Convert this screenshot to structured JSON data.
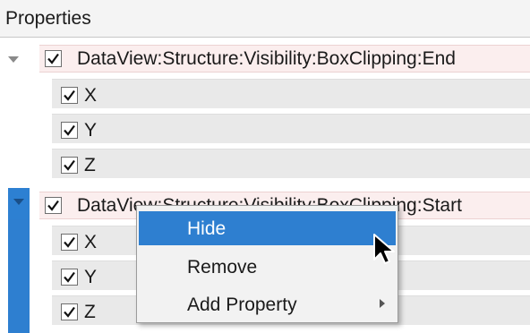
{
  "header": {
    "title": "Properties"
  },
  "groups": [
    {
      "label": "DataView:Structure:Visibility:BoxClipping:End",
      "checked": true,
      "children": [
        {
          "label": "X",
          "checked": true
        },
        {
          "label": "Y",
          "checked": true
        },
        {
          "label": "Z",
          "checked": true
        }
      ]
    },
    {
      "label": "DataView:Structure:Visibility:BoxClipping:Start",
      "checked": true,
      "children": [
        {
          "label": "X",
          "checked": true
        },
        {
          "label": "Y",
          "checked": true
        },
        {
          "label": "Z",
          "checked": true
        }
      ]
    }
  ],
  "context_menu": {
    "items": [
      {
        "label": "Hide",
        "highlighted": true,
        "has_submenu": false
      },
      {
        "label": "Remove",
        "highlighted": false,
        "has_submenu": false
      },
      {
        "label": "Add Property",
        "highlighted": false,
        "has_submenu": true
      }
    ]
  },
  "icons": {
    "expander": "triangle-down-icon",
    "check": "checkmark-icon",
    "submenu": "chevron-right-icon",
    "cursor": "mouse-pointer-icon"
  },
  "colors": {
    "selection_blue": "#2e7fd0",
    "group_band": "#fbeeee",
    "child_band": "#e9e9e9",
    "menu_bg": "#f2f2f2"
  }
}
